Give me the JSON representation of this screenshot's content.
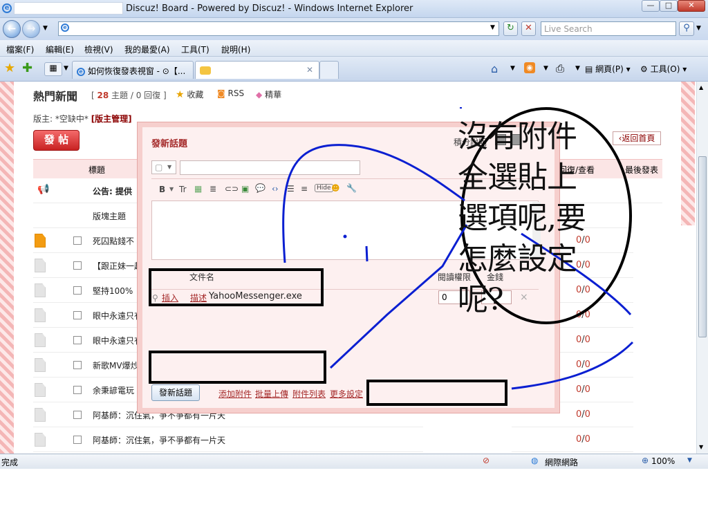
{
  "window": {
    "title": "Discuz! Board - Powered by Discuz! - Windows Internet Explorer",
    "minimize": "—",
    "maximize": "□",
    "close": "✕"
  },
  "address": {
    "url": "",
    "search_placeholder": "Live Search"
  },
  "menu": {
    "items": [
      "檔案(F)",
      "編輯(E)",
      "檢視(V)",
      "我的最愛(A)",
      "工具(T)",
      "說明(H)"
    ]
  },
  "tabs": [
    {
      "label": "如何恢復發表視窗 - ⊙【..."
    },
    {
      "label": ""
    }
  ],
  "toolbar": {
    "page_label": "網頁(P)",
    "tools_label": "工具(O)"
  },
  "forum": {
    "name": "熱門新聞",
    "topics": "28",
    "topics_text": "主題 / 0 回復 ]",
    "bracket_open": "[",
    "favorite": "收藏",
    "rss": "RSS",
    "digest": "精華",
    "moderator_label": "版主: *空缺中*",
    "moderator_admin": "[版主管理]",
    "post_button": "發 帖",
    "back_home": "返回首頁",
    "col_title": "標題",
    "col_replies": "回復/查看",
    "col_last": "最後發表",
    "announcement": "公告: 提供",
    "section_header": "版塊主題",
    "threads": [
      {
        "title": "死囚點錢不",
        "replies": "0",
        "views": "0"
      },
      {
        "title": "【跟正妹一起",
        "replies": "0",
        "views": "0"
      },
      {
        "title": "堅持100%",
        "replies": "0",
        "views": "0"
      },
      {
        "title": "眼中永遠只有",
        "replies": "0",
        "views": "0"
      },
      {
        "title": "眼中永遠只有",
        "replies": "0",
        "views": "0"
      },
      {
        "title": "新歌MV爆炒",
        "replies": "0",
        "views": "0"
      },
      {
        "title": "余秉諺電玩",
        "replies": "0",
        "views": "0"
      },
      {
        "title": "阿基師：沉住氣，爭不爭都有一片天",
        "replies": "0",
        "views": "0"
      },
      {
        "title": "阿基師：沉住氣，爭不爭都有一片天",
        "replies": "0",
        "views": "0"
      }
    ]
  },
  "dialog": {
    "title": "發新話題",
    "points_label": "積分說明",
    "filename_header": "文件名",
    "permission_header": "閱讀權限",
    "price_header": "金錢",
    "insert": "插入",
    "describe": "描述",
    "filename": "YahooMessenger.exe",
    "permission_value": "0",
    "remove": "×",
    "submit": "發新話題",
    "add_attachment": "添加附件",
    "batch_upload": "批量上傳",
    "attachment_list": "附件列表",
    "more_settings": "更多設定",
    "hide_button": "Hide"
  },
  "annotation": {
    "text_lines": [
      "沒有附件",
      "全選貼上",
      "選項呢,要",
      "怎麼設定",
      "呢?"
    ],
    "color": "#0a1fd1"
  },
  "status": {
    "left": "完成",
    "zone": "網際網路",
    "zoom": "100%"
  }
}
